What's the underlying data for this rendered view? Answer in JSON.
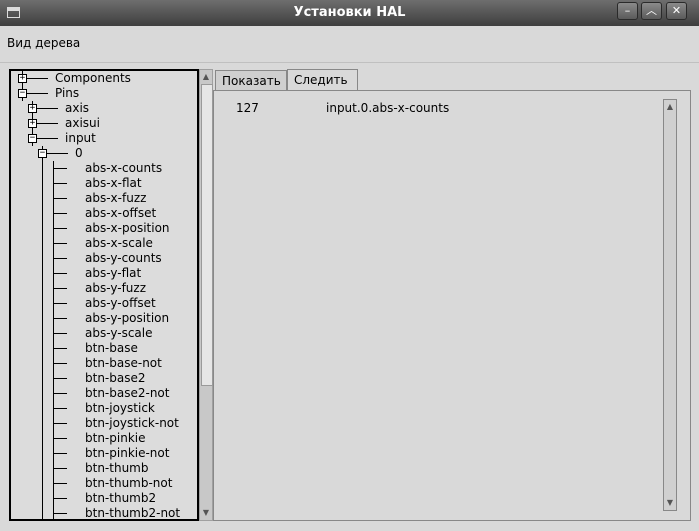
{
  "window": {
    "title": "Установки HAL"
  },
  "menu": {
    "items": [
      {
        "label": "Вид дерева"
      }
    ]
  },
  "tabs": [
    {
      "label": "Показать"
    },
    {
      "label": "Следить"
    }
  ],
  "tree": {
    "components": "Components",
    "pins": "Pins",
    "axis": "axis",
    "axisui": "axisui",
    "input": "input",
    "input_0": "0",
    "leaves": [
      "abs-x-counts",
      "abs-x-flat",
      "abs-x-fuzz",
      "abs-x-offset",
      "abs-x-position",
      "abs-x-scale",
      "abs-y-counts",
      "abs-y-flat",
      "abs-y-fuzz",
      "abs-y-offset",
      "abs-y-position",
      "abs-y-scale",
      "btn-base",
      "btn-base-not",
      "btn-base2",
      "btn-base2-not",
      "btn-joystick",
      "btn-joystick-not",
      "btn-pinkie",
      "btn-pinkie-not",
      "btn-thumb",
      "btn-thumb-not",
      "btn-thumb2",
      "btn-thumb2-not"
    ]
  },
  "watch": {
    "rows": [
      {
        "value": "127",
        "name": "input.0.abs-x-counts"
      }
    ]
  },
  "icons": {
    "minimize": "minimize-icon",
    "maximize": "maximize-icon",
    "close": "close-icon"
  }
}
